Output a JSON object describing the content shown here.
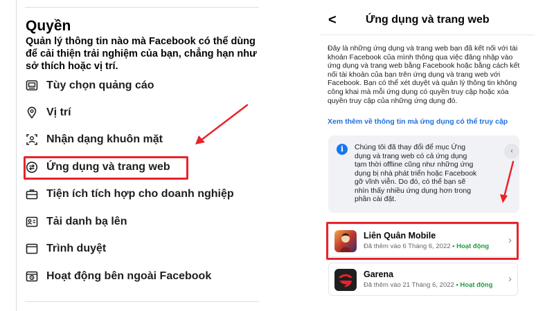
{
  "left": {
    "title": "Quyền",
    "description": "Quản lý thông tin nào mà Facebook có thể dùng để cải thiện trải nghiệm của bạn, chẳng hạn như sở thích hoặc vị trí.",
    "menu": [
      {
        "label": "Tùy chọn quảng cáo",
        "icon": "ad-preferences-icon"
      },
      {
        "label": "Vị trí",
        "icon": "location-pin-icon"
      },
      {
        "label": "Nhận dạng khuôn mặt",
        "icon": "face-recognition-icon"
      },
      {
        "label": "Ứng dụng và trang web",
        "icon": "apps-websites-icon"
      },
      {
        "label": "Tiện ích tích hợp cho doanh nghiệp",
        "icon": "business-integrations-icon"
      },
      {
        "label": "Tải danh bạ lên",
        "icon": "contacts-upload-icon"
      },
      {
        "label": "Trình duyệt",
        "icon": "browser-icon"
      },
      {
        "label": "Hoạt động bên ngoài Facebook",
        "icon": "off-facebook-activity-icon"
      }
    ]
  },
  "right": {
    "back_icon": "<",
    "title": "Ứng dụng và trang web",
    "body": "Đây là những ứng dụng và trang web bạn đã kết nối với tài khoản Facebook của mình thông qua việc đăng nhập vào ứng dụng và trang web bằng Facebook hoặc bằng cách kết nối tài khoản của bạn trên ứng dụng và trang web với Facebook. Bạn có thể xét duyệt và quản lý thông tin không công khai mà mỗi ứng dụng có quyền truy cập hoặc xóa quyền truy cập của những ứng dụng đó.",
    "link": "Xem thêm về thông tin mà ứng dụng có thể truy cập",
    "notice": {
      "info_icon": "i",
      "text": "Chúng tôi đã thay đổi để mục Ứng dụng và trang web có cả ứng dụng tạm thời offline cũng như những ứng dụng bị nhà phát triển hoặc Facebook gỡ vĩnh viễn. Do đó, có thể bạn sẽ nhìn thấy nhiều ứng dụng hơn trong phần cài đặt.",
      "close_icon": "‹"
    },
    "apps": [
      {
        "name": "Liên Quân Mobile",
        "added": "Đã thêm vào 6 Tháng 6, 2022",
        "separator": " • ",
        "status": "Hoạt động",
        "chevron": "›"
      },
      {
        "name": "Garena",
        "added": "Đã thêm vào 21 Tháng 6, 2022",
        "separator": " • ",
        "status": "Hoạt động",
        "chevron": "›"
      }
    ]
  },
  "colors": {
    "highlight": "#e8232a",
    "link": "#216fdb",
    "status": "#1e9e3e",
    "info": "#1877f2"
  }
}
